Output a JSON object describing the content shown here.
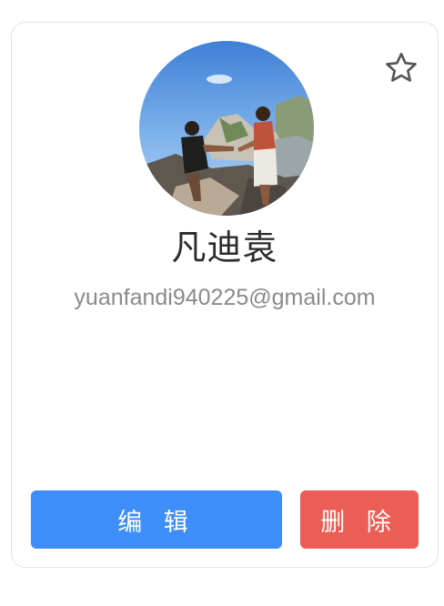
{
  "contact": {
    "name": "凡迪袁",
    "email": "yuanfandi940225@gmail.com",
    "favorite": false
  },
  "actions": {
    "edit_label": "编 辑",
    "delete_label": "删 除"
  },
  "icons": {
    "favorite": "star-outline-icon",
    "avatar": "avatar-photo"
  },
  "colors": {
    "edit": "#3d8ef8",
    "delete": "#ec5d55",
    "name_text": "#2c2c2c",
    "email_text": "#8a8a8a",
    "border": "#e3e3e3"
  }
}
